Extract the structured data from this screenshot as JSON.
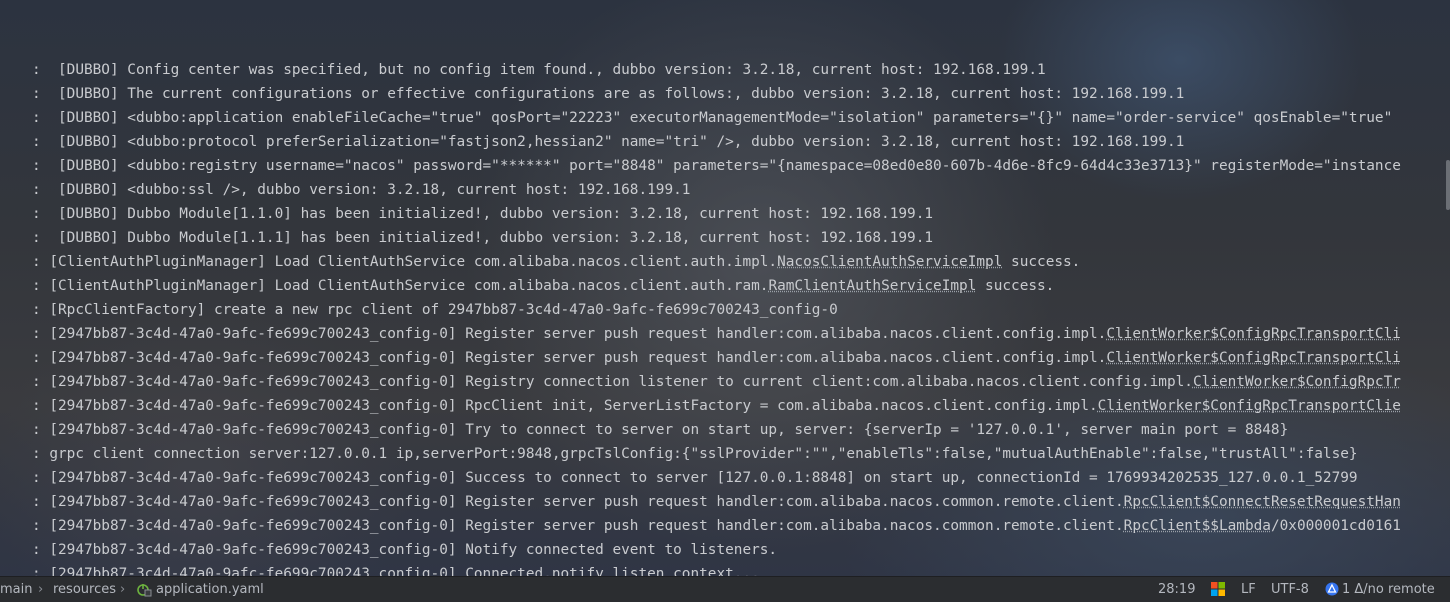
{
  "console": {
    "lines": [
      {
        "text": ":  [DUBBO] Config center was specified, but no config item found., dubbo version: 3.2.18, current host: 192.168.199.1"
      },
      {
        "text": ":  [DUBBO] The current configurations or effective configurations are as follows:, dubbo version: 3.2.18, current host: 192.168.199.1"
      },
      {
        "text": ":  [DUBBO] <dubbo:application enableFileCache=\"true\" qosPort=\"22223\" executorManagementMode=\"isolation\" parameters=\"{}\" name=\"order-service\" qosEnable=\"true\""
      },
      {
        "text": ":  [DUBBO] <dubbo:protocol preferSerialization=\"fastjson2,hessian2\" name=\"tri\" />, dubbo version: 3.2.18, current host: 192.168.199.1"
      },
      {
        "text": ":  [DUBBO] <dubbo:registry username=\"nacos\" password=\"******\" port=\"8848\" parameters=\"{namespace=08ed0e80-607b-4d6e-8fc9-64d4c33e3713}\" registerMode=\"instance"
      },
      {
        "text": ":  [DUBBO] <dubbo:ssl />, dubbo version: 3.2.18, current host: 192.168.199.1"
      },
      {
        "text": ":  [DUBBO] Dubbo Module[1.1.0] has been initialized!, dubbo version: 3.2.18, current host: 192.168.199.1"
      },
      {
        "text": ":  [DUBBO] Dubbo Module[1.1.1] has been initialized!, dubbo version: 3.2.18, current host: 192.168.199.1"
      },
      {
        "pre": ": [ClientAuthPluginManager] Load ClientAuthService com.alibaba.nacos.client.auth.impl.",
        "link": "NacosClientAuthServiceImpl",
        "post": " success."
      },
      {
        "pre": ": [ClientAuthPluginManager] Load ClientAuthService com.alibaba.nacos.client.auth.ram.",
        "link": "RamClientAuthServiceImpl",
        "post": " success."
      },
      {
        "text": ": [RpcClientFactory] create a new rpc client of 2947bb87-3c4d-47a0-9afc-fe699c700243_config-0"
      },
      {
        "pre": ": [2947bb87-3c4d-47a0-9afc-fe699c700243_config-0] Register server push request handler:com.alibaba.nacos.client.config.impl.",
        "link": "ClientWorker$ConfigRpcTransportCli",
        "post": ""
      },
      {
        "pre": ": [2947bb87-3c4d-47a0-9afc-fe699c700243_config-0] Register server push request handler:com.alibaba.nacos.client.config.impl.",
        "link": "ClientWorker$ConfigRpcTransportCli",
        "post": ""
      },
      {
        "pre": ": [2947bb87-3c4d-47a0-9afc-fe699c700243_config-0] Registry connection listener to current client:com.alibaba.nacos.client.config.impl.",
        "link": "ClientWorker$ConfigRpcTr",
        "post": ""
      },
      {
        "pre": ": [2947bb87-3c4d-47a0-9afc-fe699c700243_config-0] RpcClient init, ServerListFactory = com.alibaba.nacos.client.config.impl.",
        "link": "ClientWorker$ConfigRpcTransportClie",
        "post": ""
      },
      {
        "text": ": [2947bb87-3c4d-47a0-9afc-fe699c700243_config-0] Try to connect to server on start up, server: {serverIp = '127.0.0.1', server main port = 8848}"
      },
      {
        "text": ": grpc client connection server:127.0.0.1 ip,serverPort:9848,grpcTslConfig:{\"sslProvider\":\"\",\"enableTls\":false,\"mutualAuthEnable\":false,\"trustAll\":false}"
      },
      {
        "text": ": [2947bb87-3c4d-47a0-9afc-fe699c700243_config-0] Success to connect to server [127.0.0.1:8848] on start up, connectionId = 1769934202535_127.0.0.1_52799"
      },
      {
        "pre": ": [2947bb87-3c4d-47a0-9afc-fe699c700243_config-0] Register server push request handler:com.alibaba.nacos.common.remote.client.",
        "link": "RpcClient$ConnectResetRequestHan",
        "post": ""
      },
      {
        "pre": ": [2947bb87-3c4d-47a0-9afc-fe699c700243_config-0] Register server push request handler:com.alibaba.nacos.common.remote.client.",
        "link": "RpcClient$$Lambda",
        "post": "/0x000001cd0161"
      },
      {
        "text": ": [2947bb87-3c4d-47a0-9afc-fe699c700243_config-0] Notify connected event to listeners."
      },
      {
        "text": ": [2947bb87-3c4d-47a0-9afc-fe699c700243_config-0] Connected,notify listen context..."
      }
    ]
  },
  "statusbar": {
    "breadcrumb": [
      "main",
      "resources",
      "application.yaml"
    ],
    "file_icon": "spring-yaml-icon",
    "position": "28:19",
    "line_separator": "LF",
    "encoding": "UTF-8",
    "vcs_status": "1 Δ/no remote",
    "windows_icon": "windows-icon",
    "vcs_icon": "git-branch-icon"
  }
}
